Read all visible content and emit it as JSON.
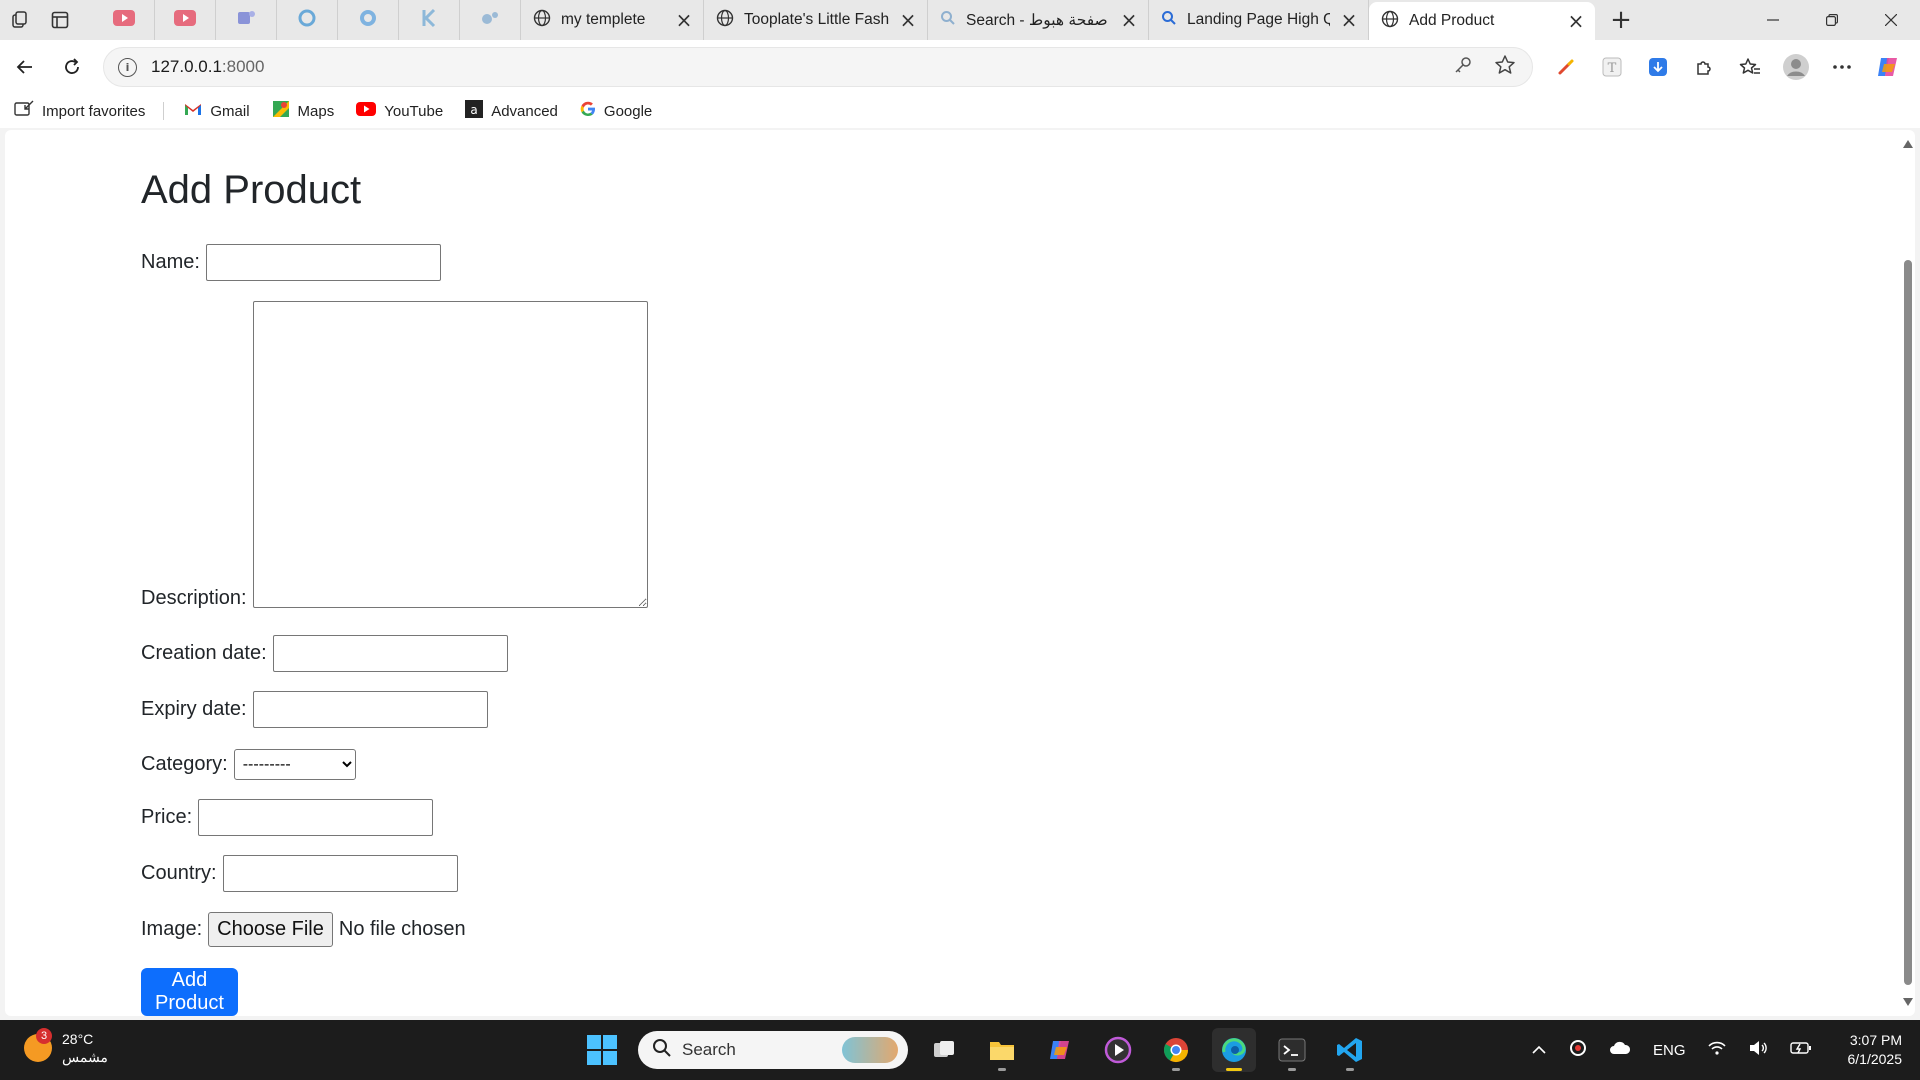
{
  "browser": {
    "tabs": [
      {
        "title": "my templete"
      },
      {
        "title": "Tooplate's Little Fashion"
      },
      {
        "title": "Search - صفحة هبوط"
      },
      {
        "title": "Landing Page High Quality"
      },
      {
        "title": "Add Product"
      }
    ],
    "url_host": "127.0.0.1",
    "url_port": ":8000",
    "bookmarks": [
      {
        "label": "Import favorites"
      },
      {
        "label": "Gmail"
      },
      {
        "label": "Maps"
      },
      {
        "label": "YouTube"
      },
      {
        "label": "Advanced"
      },
      {
        "label": "Google"
      }
    ]
  },
  "page": {
    "title": "Add Product",
    "fields": {
      "name": {
        "label": "Name:",
        "value": ""
      },
      "description": {
        "label": "Description:",
        "value": ""
      },
      "creation_date": {
        "label": "Creation date:",
        "value": ""
      },
      "expiry_date": {
        "label": "Expiry date:",
        "value": ""
      },
      "category": {
        "label": "Category:",
        "selected": "---------"
      },
      "price": {
        "label": "Price:",
        "value": ""
      },
      "country": {
        "label": "Country:",
        "value": ""
      },
      "image": {
        "label": "Image:",
        "button": "Choose File",
        "status": "No file chosen"
      }
    },
    "submit_label": "Add Product"
  },
  "taskbar": {
    "weather": {
      "temp": "28°C",
      "condition": "مشمس",
      "badge": "3"
    },
    "search_label": "Search",
    "language": "ENG",
    "time": "3:07 PM",
    "date": "6/1/2025"
  },
  "colors": {
    "primary_button": "#0d6efd",
    "taskbar": "#1c1c1c",
    "active_indicator": "#f2c811"
  }
}
